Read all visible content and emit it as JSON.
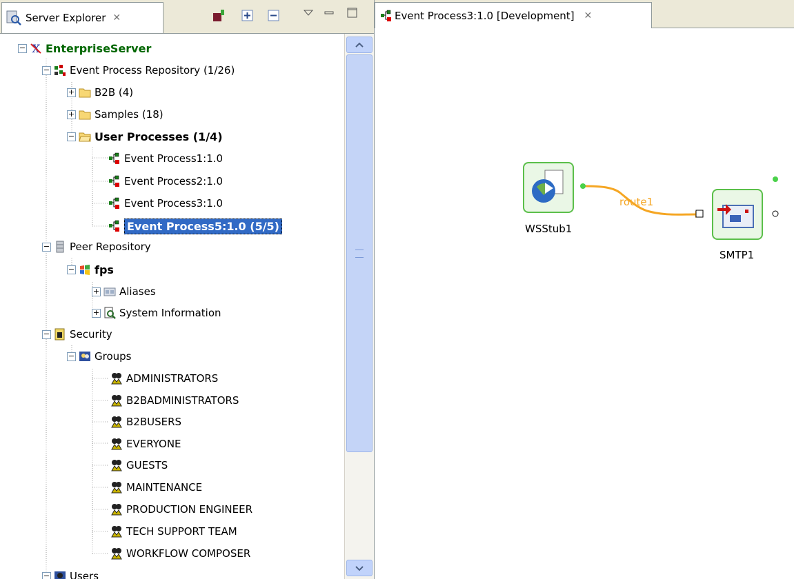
{
  "left_panel": {
    "tab_label": "Server Explorer",
    "tree": {
      "root": "EnterpriseServer",
      "event_repo": "Event Process Repository (1/26)",
      "b2b": "B2B (4)",
      "samples": "Samples (18)",
      "user_processes": "User Processes (1/4)",
      "processes": [
        "Event Process1:1.0",
        "Event Process2:1.0",
        "Event Process3:1.0",
        "Event Process5:1.0 (5/5)"
      ],
      "peer_repo": "Peer Repository",
      "fps": "fps",
      "aliases": "Aliases",
      "system_info": "System Information",
      "security": "Security",
      "groups": "Groups",
      "group_items": [
        "ADMINISTRATORS",
        "B2BADMINISTRATORS",
        "B2BUSERS",
        "EVERYONE",
        "GUESTS",
        "MAINTENANCE",
        "PRODUCTION ENGINEER",
        "TECH SUPPORT TEAM",
        "WORKFLOW COMPOSER"
      ],
      "users_partial": "Users"
    }
  },
  "editor": {
    "tab_label": "Event Process3:1.0 [Development]",
    "nodes": {
      "wsstub": "WSStub1",
      "smtp": "SMTP1"
    },
    "route_label": "route1"
  },
  "colors": {
    "root_green": "#006600",
    "route_orange": "#f5a623",
    "node_border": "#5bbf4a",
    "selection": "#316ac5"
  }
}
